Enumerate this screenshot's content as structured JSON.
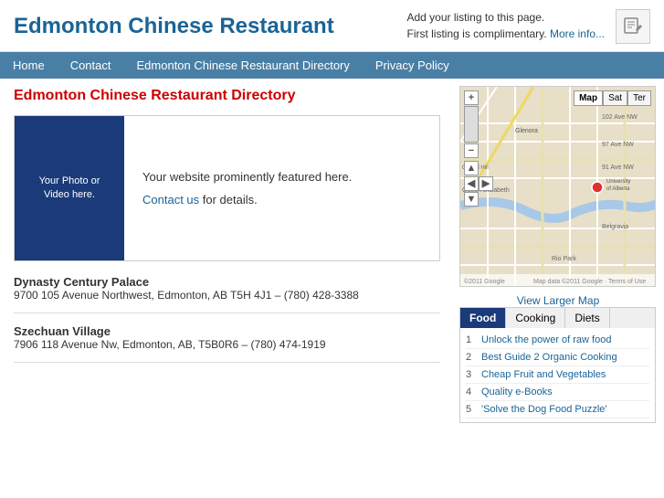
{
  "header": {
    "title": "Edmonton Chinese Restaurant",
    "promo_line1": "Add your listing to this page.",
    "promo_line2": "First listing is complimentary.",
    "promo_link": "More info...",
    "icon_label": "edit-icon"
  },
  "nav": {
    "items": [
      "Home",
      "Contact",
      "Edmonton Chinese Restaurant Directory",
      "Privacy Policy"
    ]
  },
  "page": {
    "title": "Edmonton Chinese Restaurant Directory",
    "featured": {
      "photo_text": "Your Photo or\nVideo here.",
      "desc": "Your website prominently featured here.",
      "contact_text": "Contact us",
      "contact_suffix": " for details."
    },
    "listings": [
      {
        "name": "Dynasty Century Palace",
        "address": "9700 105 Avenue Northwest, Edmonton, AB T5H 4J1 – (780) 428-3388"
      },
      {
        "name": "Szechuan Village",
        "address": "7906 118 Avenue Nw, Edmonton, AB, T5B0R6 – (780) 474-1919"
      }
    ]
  },
  "sidebar": {
    "map_link": "View Larger Map",
    "tabs": [
      "Food",
      "Cooking",
      "Diets"
    ],
    "active_tab": "Food",
    "food_items": [
      {
        "num": "1",
        "label": "Unlock the power of raw food"
      },
      {
        "num": "2",
        "label": "Best Guide 2 Organic Cooking"
      },
      {
        "num": "3",
        "label": "Cheap Fruit and Vegetables"
      },
      {
        "num": "4",
        "label": "Quality e-Books"
      },
      {
        "num": "5",
        "label": "'Solve the Dog Food Puzzle'"
      }
    ]
  },
  "colors": {
    "brand_blue": "#1a6496",
    "nav_bg": "#4a7fa5",
    "title_red": "#cc0000",
    "photo_bg": "#1a3a7a",
    "tab_active_bg": "#1a3a7a"
  }
}
